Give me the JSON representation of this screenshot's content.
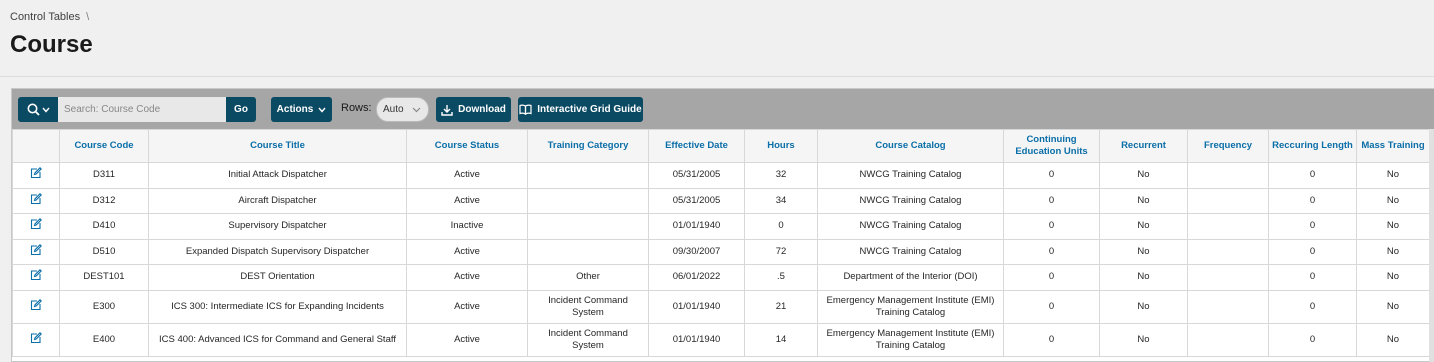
{
  "breadcrumb": {
    "item": "Control Tables",
    "separator": "\\"
  },
  "page_title": "Course",
  "toolbar": {
    "search_placeholder": "Search: Course Code",
    "go_label": "Go",
    "actions_label": "Actions",
    "rows_label": "Rows:",
    "rows_value": "Auto",
    "download_label": "Download",
    "guide_label": "Interactive Grid Guide"
  },
  "columns": [
    "Course Code",
    "Course Title",
    "Course Status",
    "Training Category",
    "Effective Date",
    "Hours",
    "Course Catalog",
    "Continuing Education Units",
    "Recurrent",
    "Frequency",
    "Reccuring Length",
    "Mass Training"
  ],
  "rows": [
    {
      "code": "D311",
      "title": "Initial Attack Dispatcher",
      "status": "Active",
      "category": "",
      "date": "05/31/2005",
      "hours": "32",
      "catalog": "NWCG Training Catalog",
      "ceu": "0",
      "recurrent": "No",
      "frequency": "",
      "length": "0",
      "mass": "No"
    },
    {
      "code": "D312",
      "title": "Aircraft Dispatcher",
      "status": "Active",
      "category": "",
      "date": "05/31/2005",
      "hours": "34",
      "catalog": "NWCG Training Catalog",
      "ceu": "0",
      "recurrent": "No",
      "frequency": "",
      "length": "0",
      "mass": "No"
    },
    {
      "code": "D410",
      "title": "Supervisory Dispatcher",
      "status": "Inactive",
      "category": "",
      "date": "01/01/1940",
      "hours": "0",
      "catalog": "NWCG Training Catalog",
      "ceu": "0",
      "recurrent": "No",
      "frequency": "",
      "length": "0",
      "mass": "No"
    },
    {
      "code": "D510",
      "title": "Expanded Dispatch Supervisory Dispatcher",
      "status": "Active",
      "category": "",
      "date": "09/30/2007",
      "hours": "72",
      "catalog": "NWCG Training Catalog",
      "ceu": "0",
      "recurrent": "No",
      "frequency": "",
      "length": "0",
      "mass": "No"
    },
    {
      "code": "DEST101",
      "title": "DEST Orientation",
      "status": "Active",
      "category": "Other",
      "date": "06/01/2022",
      "hours": ".5",
      "catalog": "Department of the Interior (DOI)",
      "ceu": "0",
      "recurrent": "No",
      "frequency": "",
      "length": "0",
      "mass": "No"
    },
    {
      "code": "E300",
      "title": "ICS 300: Intermediate ICS for Expanding Incidents",
      "status": "Active",
      "category": "Incident Command System",
      "date": "01/01/1940",
      "hours": "21",
      "catalog": "Emergency Management Institute (EMI) Training Catalog",
      "ceu": "0",
      "recurrent": "No",
      "frequency": "",
      "length": "0",
      "mass": "No"
    },
    {
      "code": "E400",
      "title": "ICS 400: Advanced ICS for Command and General Staff",
      "status": "Active",
      "category": "Incident Command System",
      "date": "01/01/1940",
      "hours": "14",
      "catalog": "Emergency Management Institute (EMI) Training Catalog",
      "ceu": "0",
      "recurrent": "No",
      "frequency": "",
      "length": "0",
      "mass": "No"
    }
  ],
  "icons": {
    "edit": "edit-icon",
    "search": "search-icon",
    "download": "download-icon",
    "guide": "book-icon"
  },
  "colors": {
    "button": "#0b4a63",
    "header_text": "#0a6ea8",
    "toolbar": "#a6a6a6"
  }
}
